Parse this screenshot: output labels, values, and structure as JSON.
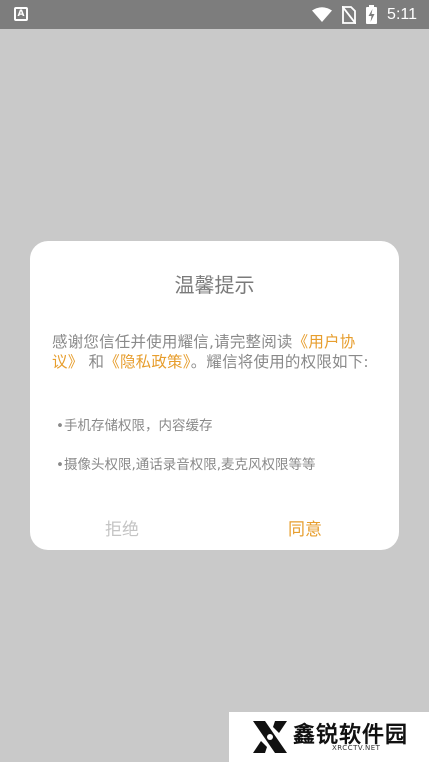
{
  "status_bar": {
    "time": "5:11",
    "left_icon": "A",
    "icons": [
      "wifi-icon",
      "no-sim-icon",
      "battery-charging-icon"
    ]
  },
  "dialog": {
    "title": "温馨提示",
    "body_prefix": "感谢您信任并使用耀信,请完整阅读",
    "link_user_agreement": "《用户协议》",
    "body_and": "和",
    "link_privacy_policy": "《隐私政策》",
    "body_suffix": "。耀信将使用的权限如下:",
    "permissions": [
      "•手机存储权限，内容缓存",
      "•摄像头权限,通话录音权限,麦克风权限等等"
    ],
    "reject_label": "拒绝",
    "agree_label": "同意",
    "accent_color": "#e79e2e"
  },
  "watermark": {
    "name": "鑫锐软件园",
    "url": "XRCCTV.NET"
  }
}
